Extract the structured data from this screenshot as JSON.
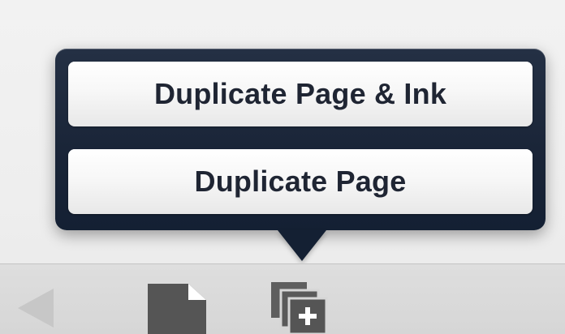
{
  "popover": {
    "items": [
      {
        "label": "Duplicate Page & Ink"
      },
      {
        "label": "Duplicate Page"
      }
    ]
  },
  "toolbar": {
    "icons": [
      "back-icon",
      "page-icon",
      "duplicate-page-icon"
    ]
  },
  "colors": {
    "popover_bg": "#1a2538",
    "button_bg": "#f7f7f7",
    "button_text": "#1f2533",
    "toolbar_bg": "#d9d9d9",
    "icon_dark": "#555555",
    "icon_light": "#c7c7c7"
  }
}
